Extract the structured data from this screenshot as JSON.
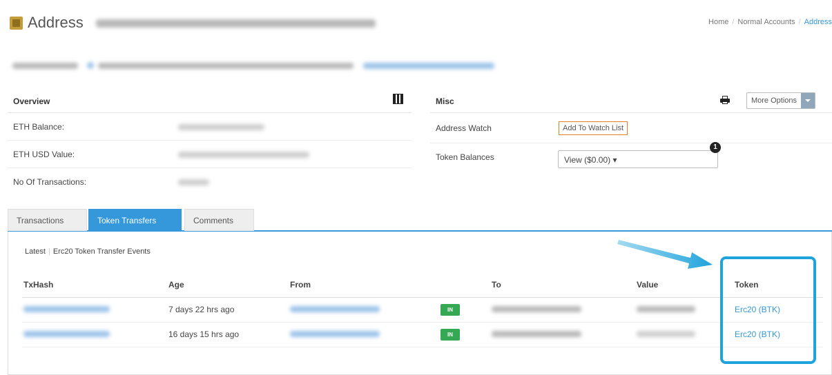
{
  "header": {
    "title": "Address",
    "breadcrumb": {
      "home": "Home",
      "sep": "/",
      "section": "Normal Accounts",
      "current": "Address"
    }
  },
  "overview": {
    "heading": "Overview",
    "rows": [
      {
        "label": "ETH Balance:"
      },
      {
        "label": "ETH USD Value:"
      },
      {
        "label": "No Of Transactions:"
      }
    ]
  },
  "misc": {
    "heading": "Misc",
    "more_options": "More Options",
    "address_watch_label": "Address Watch",
    "add_watch_button": "Add To Watch List",
    "token_balances_label": "Token Balances",
    "token_dropdown": "View ($0.00) ▾",
    "badge": "1"
  },
  "tabs": [
    {
      "label": "Transactions"
    },
    {
      "label": "Token Transfers"
    },
    {
      "label": "Comments"
    }
  ],
  "transfers": {
    "latest": "Latest",
    "sep": "|",
    "subtitle": "Erc20 Token Transfer Events",
    "columns": [
      "TxHash",
      "Age",
      "From",
      "To",
      "Value",
      "Token"
    ],
    "rows": [
      {
        "age": "7 days 22 hrs ago",
        "direction": "IN",
        "token": "Erc20 (BTK)"
      },
      {
        "age": "16 days 15 hrs ago",
        "direction": "IN",
        "token": "Erc20 (BTK)"
      }
    ]
  },
  "colors": {
    "accent": "#3498db",
    "in_badge": "#35a854",
    "highlight": "#1fa3dc",
    "watch_border": "#e67e22"
  }
}
